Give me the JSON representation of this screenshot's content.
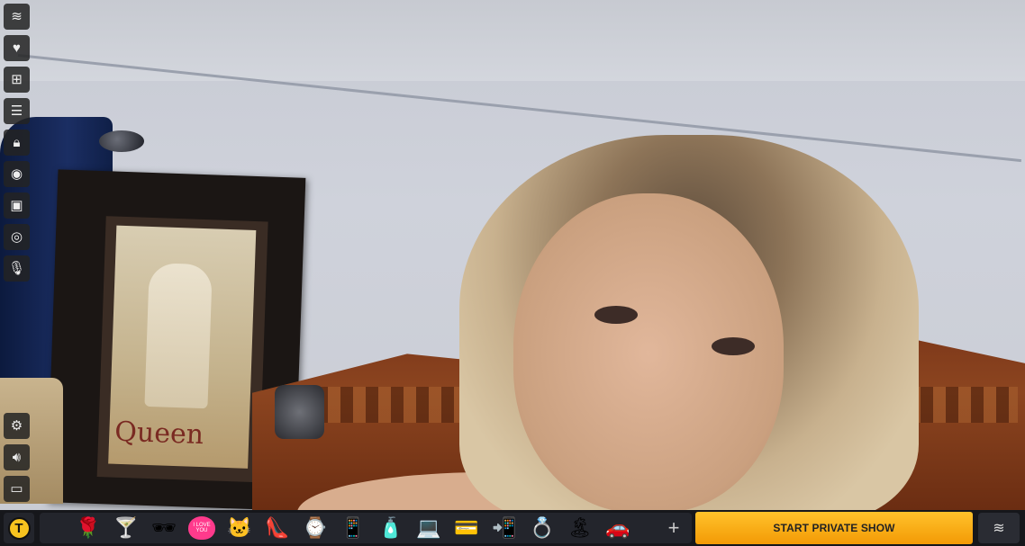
{
  "sidebar_top": [
    {
      "icon": "coins-stack-icon",
      "glyph": "≋"
    },
    {
      "icon": "heart-icon",
      "glyph": "♥"
    },
    {
      "icon": "gift-icon",
      "glyph": "⊞"
    },
    {
      "icon": "list-icon",
      "glyph": "☰"
    },
    {
      "icon": "lock-icon",
      "glyph": "🔒︎"
    },
    {
      "icon": "camera-icon",
      "glyph": "◉"
    },
    {
      "icon": "gallery-icon",
      "glyph": "▣"
    },
    {
      "icon": "webcam-icon",
      "glyph": "◎"
    },
    {
      "icon": "microphone-icon",
      "glyph": "🎙︎"
    }
  ],
  "sidebar_bottom": [
    {
      "icon": "settings-icon",
      "glyph": "⚙"
    },
    {
      "icon": "volume-icon",
      "glyph": "🔊︎"
    },
    {
      "icon": "fullscreen-icon",
      "glyph": "▭"
    }
  ],
  "video": {
    "poster_text": "Queen"
  },
  "bottom_bar": {
    "token_label": "T",
    "gifts": [
      {
        "icon": "rose-icon",
        "glyph": "🌹"
      },
      {
        "icon": "cocktail-icon",
        "glyph": "🍸"
      },
      {
        "icon": "heart-glasses-icon",
        "glyph": "🕶"
      },
      {
        "icon": "i-love-you-heart-icon",
        "text": "I LOVE YOU"
      },
      {
        "icon": "cat-gift-icon",
        "glyph": "🐱"
      },
      {
        "icon": "high-heels-icon",
        "glyph": "👠"
      },
      {
        "icon": "smartwatch-icon",
        "glyph": "⌚"
      },
      {
        "icon": "smartphone-icon",
        "glyph": "📱"
      },
      {
        "icon": "perfume-icon",
        "glyph": "🧴"
      },
      {
        "icon": "laptop-icon",
        "glyph": "💻"
      },
      {
        "icon": "credit-card-icon",
        "glyph": "💳"
      },
      {
        "icon": "tablet-icon",
        "glyph": "📲"
      },
      {
        "icon": "diamond-ring-icon",
        "glyph": "💍"
      },
      {
        "icon": "beach-vacation-icon",
        "glyph": "🏝"
      },
      {
        "icon": "sports-car-icon",
        "glyph": "🚗"
      }
    ],
    "add_label": "+",
    "private_show_label": "START PRIVATE SHOW",
    "balance_glyph": "≋"
  },
  "colors": {
    "accent": "#f7a81b",
    "bar_bg": "#16171b"
  }
}
